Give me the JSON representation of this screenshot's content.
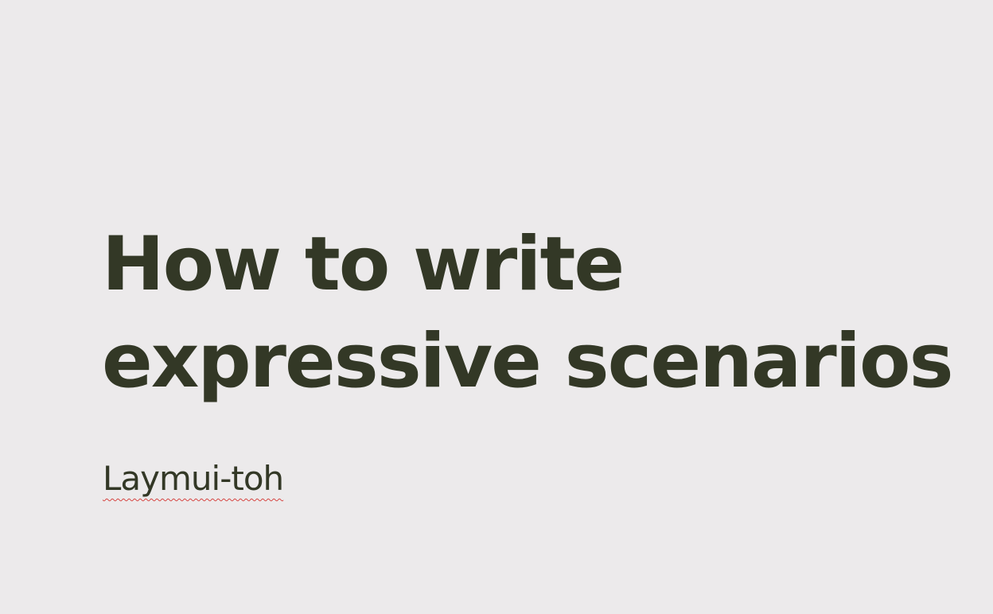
{
  "slide": {
    "title_lines": [
      "How to write",
      "expressive scenarios"
    ],
    "subtitle": "Laymui-toh"
  },
  "colors": {
    "background": "#ECEAEB",
    "text": "#333826",
    "spellcheck_underline": "#D64541"
  }
}
